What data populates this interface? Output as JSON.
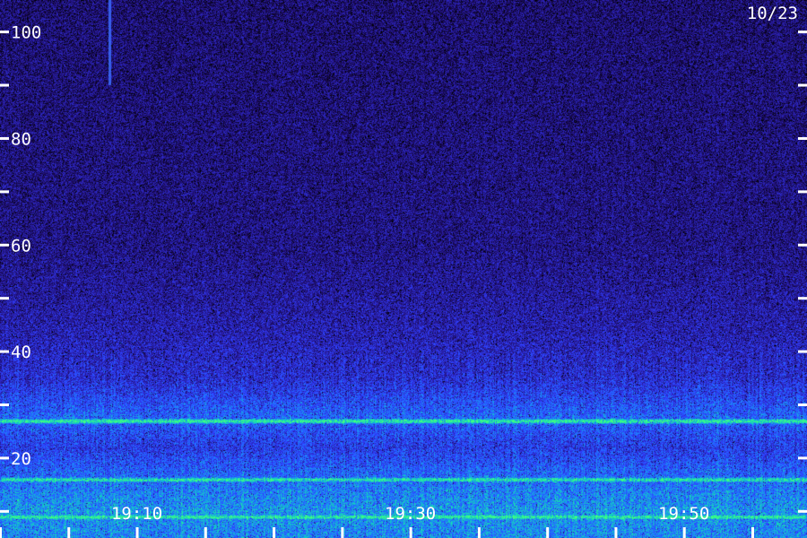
{
  "chart_data": {
    "type": "heatmap",
    "title": "",
    "xlabel": "",
    "ylabel": "",
    "date_label": "10/23",
    "y_ticks_labeled": [
      {
        "value": 100,
        "label": "100"
      },
      {
        "value": 80,
        "label": "80"
      },
      {
        "value": 60,
        "label": "60"
      },
      {
        "value": 40,
        "label": "40"
      },
      {
        "value": 20,
        "label": "20"
      }
    ],
    "y_ticks_minor": [
      90,
      70,
      50,
      30,
      10
    ],
    "ylim": [
      5,
      106
    ],
    "x_ticks_labeled": [
      {
        "value": "19:10",
        "label": "19:10"
      },
      {
        "value": "19:30",
        "label": "19:30"
      },
      {
        "value": "19:50",
        "label": "19:50"
      }
    ],
    "x_tick_interval_minutes": 5,
    "xlim": [
      "19:00",
      "19:59"
    ],
    "colormap": [
      "#000000",
      "#1a0a5c",
      "#2a1fa8",
      "#2f3fff",
      "#1e7fff",
      "#10d0c0",
      "#40ff80"
    ],
    "intensity_profile": [
      {
        "y": 105,
        "level": 0.22
      },
      {
        "y": 60,
        "level": 0.26
      },
      {
        "y": 45,
        "level": 0.34
      },
      {
        "y": 35,
        "level": 0.42
      },
      {
        "y": 28,
        "level": 0.6
      },
      {
        "y": 22,
        "level": 0.48
      },
      {
        "y": 18,
        "level": 0.58
      },
      {
        "y": 14,
        "level": 0.66
      },
      {
        "y": 10,
        "level": 0.72
      },
      {
        "y": 6,
        "level": 0.68
      }
    ],
    "bands": [
      {
        "y": 27,
        "level": 0.85
      },
      {
        "y": 16,
        "level": 0.8
      },
      {
        "y": 9,
        "level": 0.82
      }
    ],
    "transients": [
      {
        "time": "19:08",
        "y_from": 90,
        "y_to": 106
      }
    ]
  }
}
